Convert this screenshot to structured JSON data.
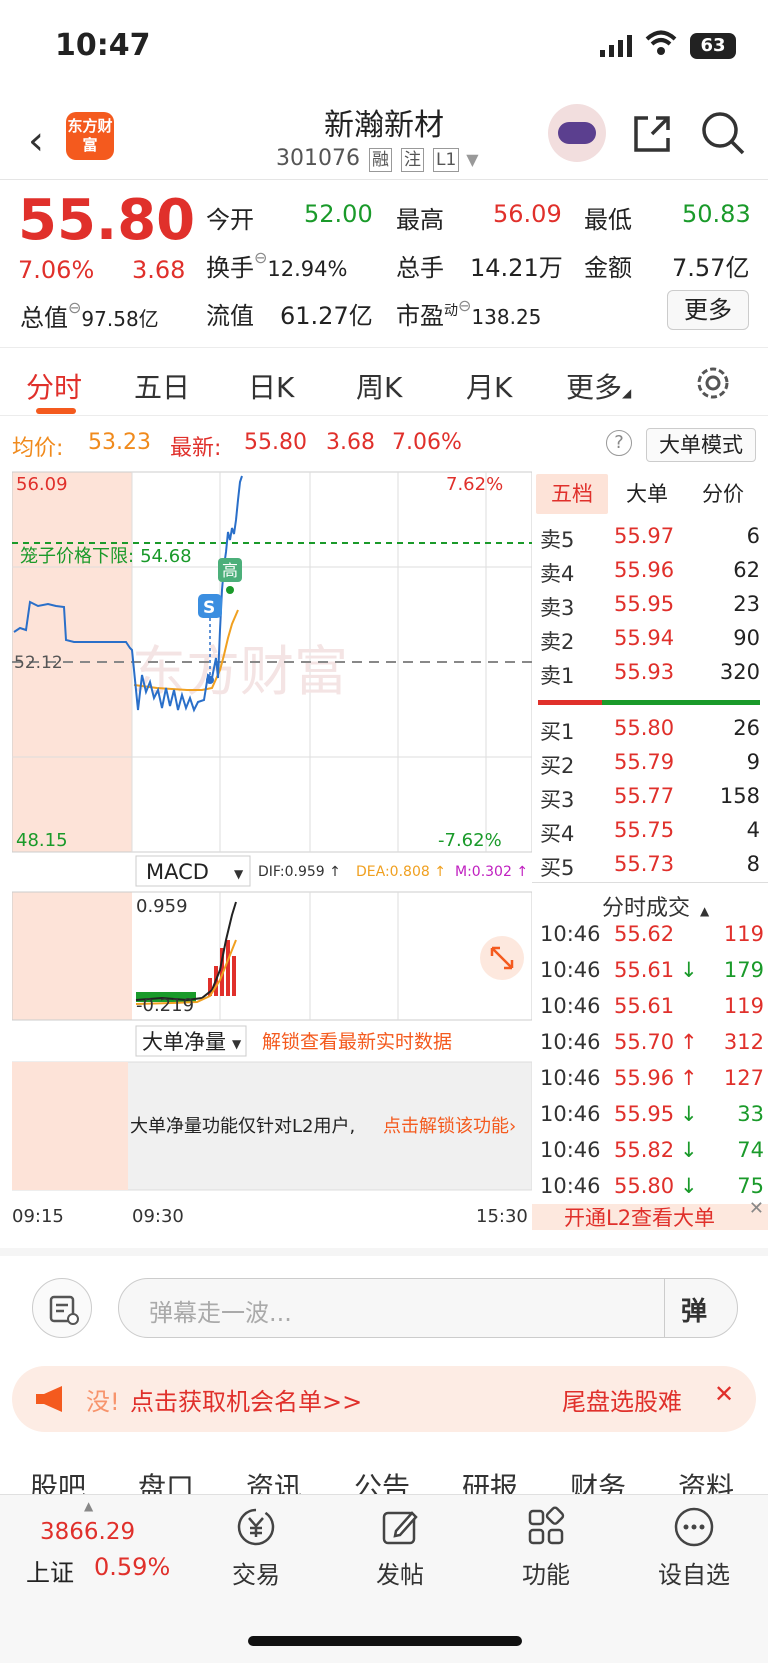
{
  "status_bar": {
    "time": "10:47",
    "battery": "63"
  },
  "header": {
    "name": "新瀚新材",
    "code": "301076",
    "tags": [
      "融",
      "注",
      "L1"
    ],
    "logo_text": "东方财富"
  },
  "quote": {
    "price": "55.80",
    "change_pct": "7.06%",
    "change": "3.68",
    "open_label": "今开",
    "open": "52.00",
    "high_label": "最高",
    "high": "56.09",
    "low_label": "最低",
    "low": "50.83",
    "turnover_label": "换手",
    "turnover": "12.94%",
    "volume_label": "总手",
    "volume": "14.21万",
    "amount_label": "金额",
    "amount": "7.57亿",
    "mcap_label": "总值",
    "mcap": "97.58亿",
    "float_label": "流值",
    "float": "61.27亿",
    "pe_label": "市盈",
    "pe_sup": "动",
    "pe": "138.25",
    "more": "更多"
  },
  "tabs": [
    "分时",
    "五日",
    "日K",
    "周K",
    "月K",
    "更多"
  ],
  "avg": {
    "avg_label": "均价:",
    "avg": "53.23",
    "latest_label": "最新:",
    "latest": "55.80",
    "chg": "3.68",
    "pct": "7.06%",
    "mode": "大单模式",
    "help": "?"
  },
  "chart": {
    "top": "56.09",
    "bottom": "48.15",
    "mid": "52.12",
    "top_pct": "7.62%",
    "bottom_pct": "-7.62%",
    "limit_label": "笼子价格下限:",
    "limit": "54.68",
    "high_tag": "高",
    "s_tag": "S",
    "watermark": "东方财富",
    "macd_label": "MACD",
    "dif": "DIF:0.959 ↑",
    "dea": "DEA:0.808 ↑",
    "m": "M:0.302 ↑",
    "macd_top": "0.959",
    "macd_bottom": "-0.219",
    "bignet_label": "大单净量",
    "unlock_text": "解锁查看最新实时数据",
    "bignet_msg": "大单净量功能仅针对L2用户,",
    "bignet_link": "点击解锁该功能",
    "times": [
      "09:15",
      "09:30",
      "15:30"
    ]
  },
  "orderbook": {
    "tabs": [
      "五档",
      "大单",
      "分价"
    ],
    "sell": [
      [
        "卖5",
        "55.97",
        "6"
      ],
      [
        "卖4",
        "55.96",
        "62"
      ],
      [
        "卖3",
        "55.95",
        "23"
      ],
      [
        "卖2",
        "55.94",
        "90"
      ],
      [
        "卖1",
        "55.93",
        "320"
      ]
    ],
    "buy": [
      [
        "买1",
        "55.80",
        "26"
      ],
      [
        "买2",
        "55.79",
        "9"
      ],
      [
        "买3",
        "55.77",
        "158"
      ],
      [
        "买4",
        "55.75",
        "4"
      ],
      [
        "买5",
        "55.73",
        "8"
      ]
    ]
  },
  "trades": {
    "title": "分时成交",
    "rows": [
      [
        "10:46",
        "55.62",
        "",
        "119"
      ],
      [
        "10:46",
        "55.61",
        "down",
        "179"
      ],
      [
        "10:46",
        "55.61",
        "",
        "119"
      ],
      [
        "10:46",
        "55.70",
        "up",
        "312"
      ],
      [
        "10:46",
        "55.96",
        "up",
        "127"
      ],
      [
        "10:46",
        "55.95",
        "down",
        "33"
      ],
      [
        "10:46",
        "55.82",
        "down",
        "74"
      ],
      [
        "10:46",
        "55.80",
        "down",
        "75"
      ]
    ],
    "l2_promo": "开通L2查看大单"
  },
  "comment": {
    "placeholder": "弹幕走一波...",
    "send": "弹"
  },
  "banner": {
    "left": "没!",
    "main": "点击获取机会名单>>",
    "right": "尾盘选股难"
  },
  "subtabs": [
    "股吧",
    "盘口",
    "资讯",
    "公告",
    "研报",
    "财务",
    "资料"
  ],
  "bottom_nav": {
    "index_value": "3866.29",
    "index_name": "上证",
    "index_pct": "0.59%",
    "items": [
      "交易",
      "发帖",
      "功能",
      "设自选"
    ]
  }
}
